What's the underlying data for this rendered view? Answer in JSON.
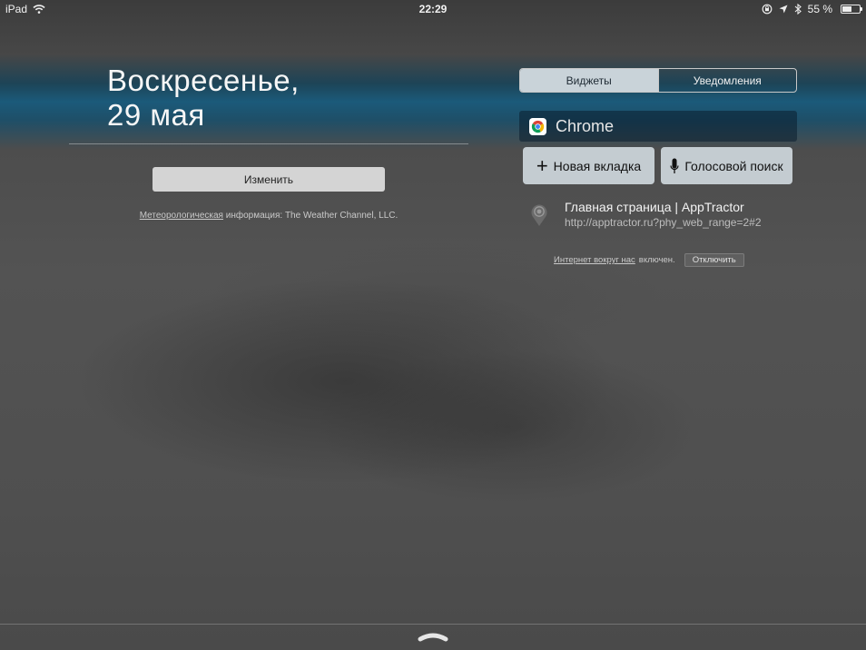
{
  "status_bar": {
    "device": "iPad",
    "time": "22:29",
    "battery": "55 %",
    "battery_level": 0.55,
    "icons": [
      "wifi-icon",
      "orientation-lock-icon",
      "location-arrow-icon",
      "bluetooth-icon",
      "battery-icon"
    ]
  },
  "today": {
    "weekday": "Воскресенье,",
    "date": "29 мая",
    "edit_button": "Изменить",
    "weather_link": "Метеорологическая",
    "weather_rest": " информация: The Weather Channel, LLC."
  },
  "tabs": [
    {
      "label": "Виджеты",
      "active": true
    },
    {
      "label": "Уведомления",
      "active": false
    }
  ],
  "chrome_widget": {
    "title": "Chrome",
    "new_tab": "Новая вкладка",
    "voice_search": "Голосовой поиск",
    "nearby": {
      "title": "Главная страница | AppTractor",
      "url": "http://apptractor.ru?phy_web_range=2#2"
    },
    "physical_web": {
      "link": "Интернет вокруг нас",
      "status": " включен.",
      "off_button": "Отключить"
    }
  },
  "colors": {
    "active_tab": "#c9d3d9",
    "action_button": "#c4ccd1"
  }
}
